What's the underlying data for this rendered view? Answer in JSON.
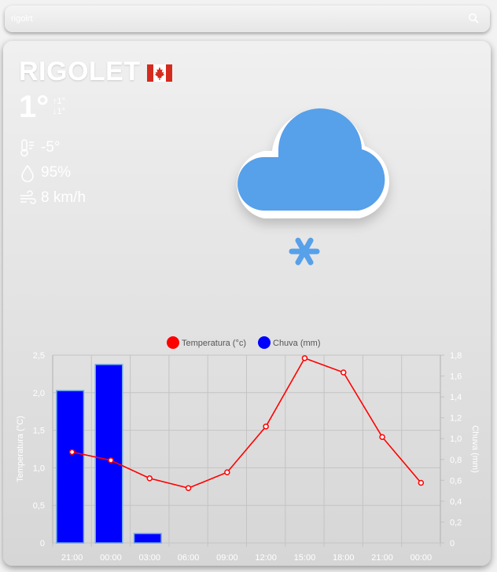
{
  "search": {
    "value": "rigolrt"
  },
  "location": {
    "city": "RIGOLET",
    "flag": "canada-flag"
  },
  "current": {
    "temperature": "1°",
    "max": "↑1°",
    "min": "↓1°",
    "feels_like": "-5°",
    "humidity": "95%",
    "wind": "8 km/h",
    "condition_icon": "snow-cloud-icon"
  },
  "chart_data": {
    "type": "bar",
    "categories": [
      "21:00",
      "00:00",
      "03:00",
      "06:00",
      "09:00",
      "12:00",
      "15:00",
      "18:00",
      "21:00",
      "00:00"
    ],
    "series": [
      {
        "name": "Temperatura (°c)",
        "type": "line",
        "axis": "left",
        "color": "#ff0000",
        "values": [
          1.21,
          1.1,
          0.86,
          0.73,
          0.94,
          1.55,
          2.46,
          2.27,
          1.41,
          0.8
        ]
      },
      {
        "name": "Chuva (mm)",
        "type": "bar",
        "axis": "right",
        "color": "#0000ff",
        "values": [
          1.46,
          1.71,
          0.09,
          0,
          0,
          0,
          0,
          0,
          0,
          0
        ]
      }
    ],
    "ylabel": "Temperatura (°C)",
    "y2label": "Chuva (mm)",
    "ylim": [
      0,
      2.5
    ],
    "y2lim": [
      0,
      1.8
    ],
    "yticks": [
      "0",
      "0,5",
      "1,0",
      "1,5",
      "2,0",
      "2,5"
    ],
    "y2ticks": [
      "0",
      "0,2",
      "0,4",
      "0,6",
      "0,8",
      "1,0",
      "1,2",
      "1,4",
      "1,6",
      "1,8"
    ],
    "legend_position": "top",
    "grid": true
  }
}
